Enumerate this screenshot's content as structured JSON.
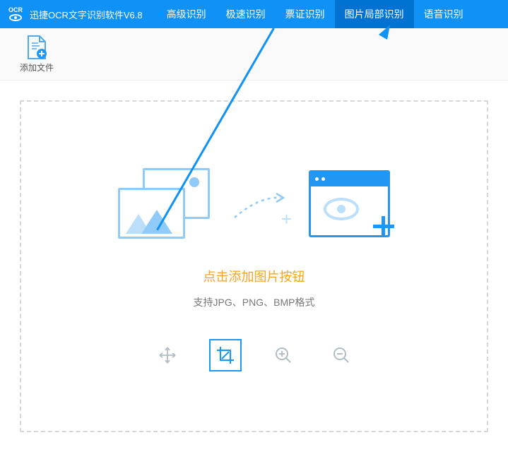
{
  "header": {
    "app_title": "迅捷OCR文字识别软件V6.8",
    "tabs": [
      {
        "label": "高级识别"
      },
      {
        "label": "极速识别"
      },
      {
        "label": "票证识别"
      },
      {
        "label": "图片局部识别"
      },
      {
        "label": "语音识别"
      }
    ],
    "active_tab_index": 3
  },
  "toolbar": {
    "add_file_label": "添加文件"
  },
  "dropzone": {
    "main_prompt": "点击添加图片按钮",
    "sub_prompt": "支持JPG、PNG、BMP格式"
  },
  "tools": {
    "move": "move-icon",
    "crop": "crop-icon",
    "zoom_in": "zoom-in-icon",
    "zoom_out": "zoom-out-icon",
    "active_tool_index": 1
  }
}
